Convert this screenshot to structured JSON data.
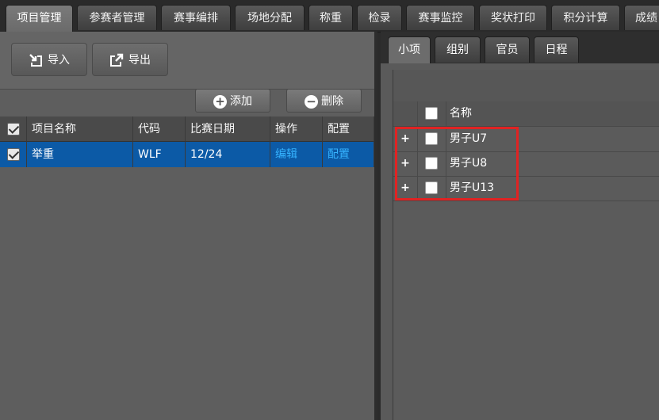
{
  "main_tabs": [
    "项目管理",
    "参赛者管理",
    "赛事编排",
    "场地分配",
    "称重",
    "检录",
    "赛事监控",
    "奖状打印",
    "积分计算",
    "成绩"
  ],
  "toolbar": {
    "import_label": "导入",
    "export_label": "导出",
    "add_label": "添加",
    "delete_label": "删除"
  },
  "project_table": {
    "headers": [
      "项目名称",
      "代码",
      "比赛日期",
      "操作",
      "配置"
    ],
    "rows": [
      {
        "name": "举重",
        "code": "WLF",
        "date": "12/24",
        "action": "编辑",
        "config": "配置",
        "checked": true
      }
    ]
  },
  "sub_tabs": [
    "小项",
    "组别",
    "官员",
    "日程"
  ],
  "sub_table": {
    "header": "名称",
    "expand_symbol": "+",
    "rows": [
      "男子U7",
      "男子U8",
      "男子U13"
    ]
  },
  "colors": {
    "selection": "#0c5aa6",
    "link": "#35b3ff",
    "highlight_box": "#e02323"
  }
}
